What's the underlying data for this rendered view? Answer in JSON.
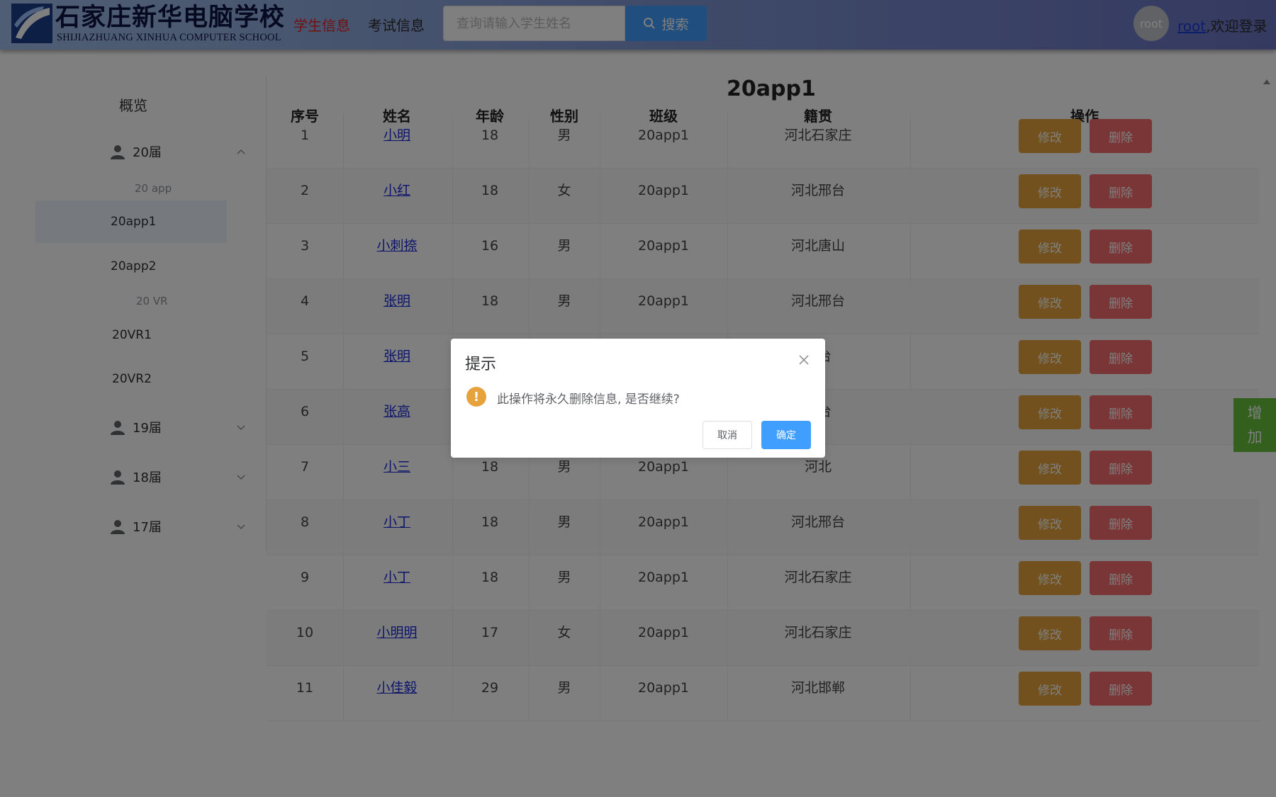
{
  "header": {
    "logo_cn": "石家庄新华电脑学校",
    "logo_en": "SHIJIAZHUANG XINHUA COMPUTER SCHOOL",
    "nav": [
      {
        "label": "学生信息",
        "active": true
      },
      {
        "label": "考试信息",
        "active": false
      }
    ],
    "search": {
      "placeholder": "查询请输入学生姓名",
      "value": "",
      "button_label": "搜索"
    },
    "user": {
      "avatar_text": "root",
      "username": "root",
      "welcome_suffix": ",欢迎登录"
    }
  },
  "sidebar": {
    "overview": "概览",
    "groups": [
      {
        "label": "20届",
        "expanded": true,
        "subgroups": [
          {
            "label": "20 app",
            "items": [
              "20app1",
              "20app2"
            ]
          },
          {
            "label": "20 VR",
            "items": [
              "20VR1",
              "20VR2"
            ]
          }
        ]
      },
      {
        "label": "19届",
        "expanded": false
      },
      {
        "label": "18届",
        "expanded": false
      },
      {
        "label": "17届",
        "expanded": false
      }
    ],
    "active_item": "20app1"
  },
  "main": {
    "title": "20app1",
    "columns": [
      "序号",
      "姓名",
      "年龄",
      "性别",
      "班级",
      "籍贯",
      "操作"
    ],
    "edit_label": "修改",
    "delete_label": "删除",
    "rows": [
      {
        "id": "1",
        "name": "小明",
        "age": "18",
        "gender": "男",
        "class": "20app1",
        "hometown": "河北石家庄"
      },
      {
        "id": "2",
        "name": "小红",
        "age": "18",
        "gender": "女",
        "class": "20app1",
        "hometown": "河北邢台"
      },
      {
        "id": "3",
        "name": "小刺捺",
        "age": "16",
        "gender": "男",
        "class": "20app1",
        "hometown": "河北唐山"
      },
      {
        "id": "4",
        "name": "张明",
        "age": "18",
        "gender": "男",
        "class": "20app1",
        "hometown": "河北邢台"
      },
      {
        "id": "5",
        "name": "张明",
        "age": "",
        "gender": "",
        "class": "",
        "hometown": "邢台"
      },
      {
        "id": "6",
        "name": "张高",
        "age": "",
        "gender": "",
        "class": "",
        "hometown": "邢台"
      },
      {
        "id": "7",
        "name": "小三",
        "age": "18",
        "gender": "男",
        "class": "20app1",
        "hometown": "河北"
      },
      {
        "id": "8",
        "name": "小丁",
        "age": "18",
        "gender": "男",
        "class": "20app1",
        "hometown": "河北邢台"
      },
      {
        "id": "9",
        "name": "小丁",
        "age": "18",
        "gender": "男",
        "class": "20app1",
        "hometown": "河北石家庄"
      },
      {
        "id": "10",
        "name": "小明明",
        "age": "17",
        "gender": "女",
        "class": "20app1",
        "hometown": "河北石家庄"
      },
      {
        "id": "11",
        "name": "小佳毅",
        "age": "29",
        "gender": "男",
        "class": "20app1",
        "hometown": "河北邯郸"
      }
    ],
    "add_label": [
      "增",
      "加"
    ]
  },
  "dialog": {
    "title": "提示",
    "message": "此操作将永久删除信息, 是否继续?",
    "warn_glyph": "!",
    "cancel_label": "取消",
    "confirm_label": "确定"
  },
  "colors": {
    "primary": "#409eff",
    "warning": "#e6a23c",
    "danger": "#f56c6c",
    "success": "#67c23a",
    "nav_active": "#e02424"
  }
}
